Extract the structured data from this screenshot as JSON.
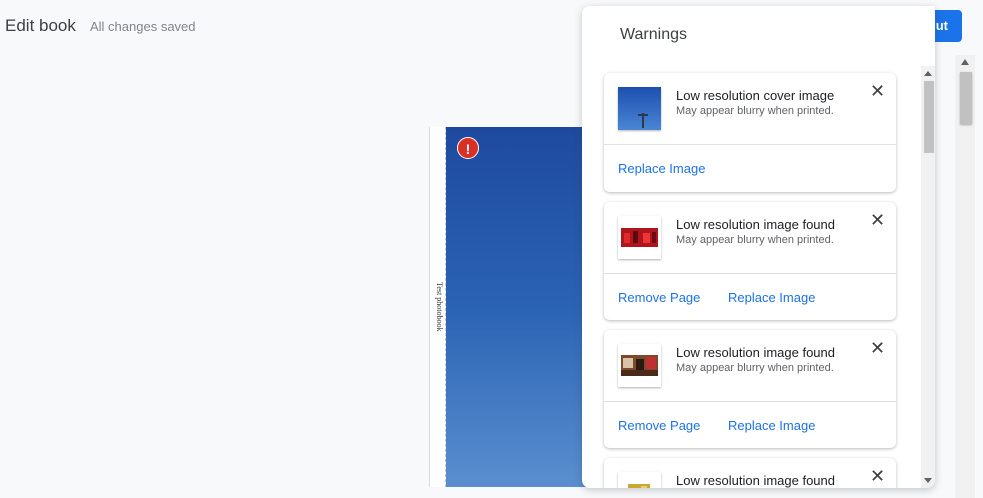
{
  "header": {
    "title": "Edit book",
    "status": "All changes saved",
    "checkout_label": "ut"
  },
  "book": {
    "spine_text": "Test photobook",
    "alert_symbol": "!"
  },
  "panel": {
    "title": "Warnings",
    "close_symbol": "✕",
    "cards": [
      {
        "title": "Low resolution cover image",
        "subtitle": "May appear blurry when printed.",
        "actions": [
          "Replace Image"
        ],
        "thumb": "blue-sky"
      },
      {
        "title": "Low resolution image found",
        "subtitle": "May appear blurry when printed.",
        "actions": [
          "Remove Page",
          "Replace Image"
        ],
        "thumb": "red-crowd"
      },
      {
        "title": "Low resolution image found",
        "subtitle": "May appear blurry when printed.",
        "actions": [
          "Remove Page",
          "Replace Image"
        ],
        "thumb": "indoor-scene"
      },
      {
        "title": "Low resolution image found",
        "subtitle": "",
        "actions": [],
        "thumb": "yellow-scene"
      }
    ]
  },
  "colors": {
    "accent": "#1a73e8",
    "alert": "#d93025",
    "cover_top": "#1e4a9e",
    "cover_bottom": "#5a8fcf"
  }
}
